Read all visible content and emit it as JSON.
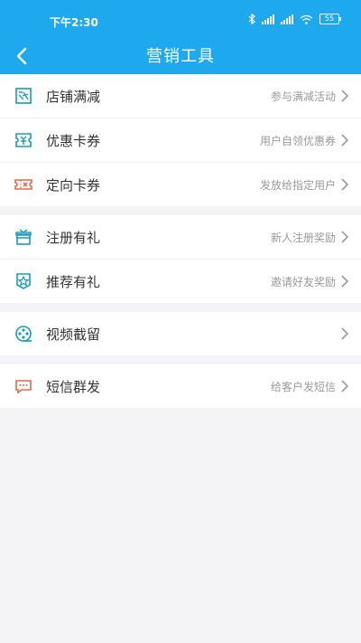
{
  "status_bar": {
    "time": "下午2:30",
    "battery": "55"
  },
  "header": {
    "title": "营销工具"
  },
  "groups": [
    {
      "items": [
        {
          "label": "店铺满减",
          "hint": "参与满减活动"
        },
        {
          "label": "优惠卡券",
          "hint": "用户自领优惠券"
        },
        {
          "label": "定向卡券",
          "hint": "发放给指定用户"
        }
      ]
    },
    {
      "items": [
        {
          "label": "注册有礼",
          "hint": "新人注册奖励"
        },
        {
          "label": "推荐有礼",
          "hint": "邀请好友奖励"
        }
      ]
    },
    {
      "items": [
        {
          "label": "视频截留",
          "hint": ""
        }
      ]
    },
    {
      "items": [
        {
          "label": "短信群发",
          "hint": "给客户发短信"
        }
      ]
    }
  ],
  "colors": {
    "accent": "#1ea9ef",
    "icon_teal": "#1d9ab8",
    "icon_red": "#e06a4c"
  }
}
